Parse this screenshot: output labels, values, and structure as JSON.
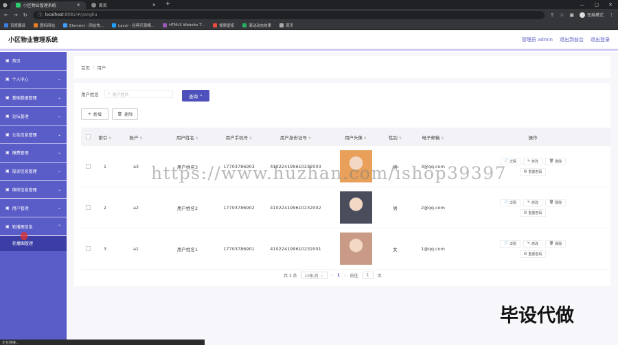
{
  "browser": {
    "tabs": [
      {
        "label": "小区物业管理系统",
        "active": true,
        "color": "#2ecc71"
      },
      {
        "label": "首页",
        "active": false,
        "color": "#888888"
      }
    ],
    "new_tab": "+",
    "url_host": "localhost",
    "url_rest": ":8081/#/yonghu",
    "profile": "无痕模式",
    "bookmarks": [
      {
        "label": "百度翻译",
        "color": "#3b7ddd"
      },
      {
        "label": "图标网站",
        "color": "#e67e22"
      },
      {
        "label": "Element - 网站快...",
        "color": "#409eff"
      },
      {
        "label": "Layui - 经典开源模...",
        "color": "#1e9fff"
      },
      {
        "label": "HTML5 Website T...",
        "color": "#9b59b6"
      },
      {
        "label": "搜索壁纸",
        "color": "#e74c3c"
      },
      {
        "label": "滚动动态效果",
        "color": "#27ae60"
      },
      {
        "label": "首页",
        "color": "#aaaaaa"
      }
    ]
  },
  "header": {
    "title": "小区物业管理系统",
    "admin": "管理员 admin",
    "back_front": "退出到前台",
    "logout": "退出登录"
  },
  "sidebar": {
    "items": [
      {
        "label": "首页"
      },
      {
        "label": "个人中心"
      },
      {
        "label": "基础数据管理"
      },
      {
        "label": "论坛管理"
      },
      {
        "label": "公告信息管理"
      },
      {
        "label": "缴费管理"
      },
      {
        "label": "投诉信息管理"
      },
      {
        "label": "维修信息管理"
      },
      {
        "label": "用户管理"
      },
      {
        "label": "轮播图信息"
      }
    ],
    "sub_item": "轮播图管理"
  },
  "breadcrumb": {
    "home": "首页",
    "sep": "/",
    "current": "用户"
  },
  "search": {
    "label": "用户姓名",
    "placeholder": "用户姓名",
    "button": "查询"
  },
  "actions": {
    "add": "新增",
    "delete": "删除"
  },
  "table": {
    "headers": [
      "索引",
      "账户",
      "用户姓名",
      "用户手机号",
      "用户身份证号",
      "用户头像",
      "性别",
      "电子邮箱",
      "操作"
    ],
    "rows": [
      {
        "index": "1",
        "account": "a3",
        "name": "用户姓名3",
        "phone": "17703786903",
        "idcard": "410224199610232003",
        "gender": "男",
        "email": "3@qq.com",
        "avatar_color": "#e8a05a"
      },
      {
        "index": "2",
        "account": "a2",
        "name": "用户姓名2",
        "phone": "17703786902",
        "idcard": "410224199610232002",
        "gender": "男",
        "email": "2@qq.com",
        "avatar_color": "#4a4e5c"
      },
      {
        "index": "3",
        "account": "a1",
        "name": "用户姓名1",
        "phone": "17703786901",
        "idcard": "410224199610232001",
        "gender": "女",
        "email": "1@qq.com",
        "avatar_color": "#c99a85"
      }
    ],
    "op_labels": {
      "detail": "详情",
      "edit": "修改",
      "delete": "删除",
      "reset": "重置密码"
    }
  },
  "pagination": {
    "total": "共 3 条",
    "page_size": "10条/页",
    "current": "1",
    "goto": "前往",
    "goto_value": "1",
    "unit": "页"
  },
  "overlays": {
    "watermark": "https://www.huzhan.com/ishop39397",
    "promo": "毕设代做",
    "status": "正在连接..."
  }
}
